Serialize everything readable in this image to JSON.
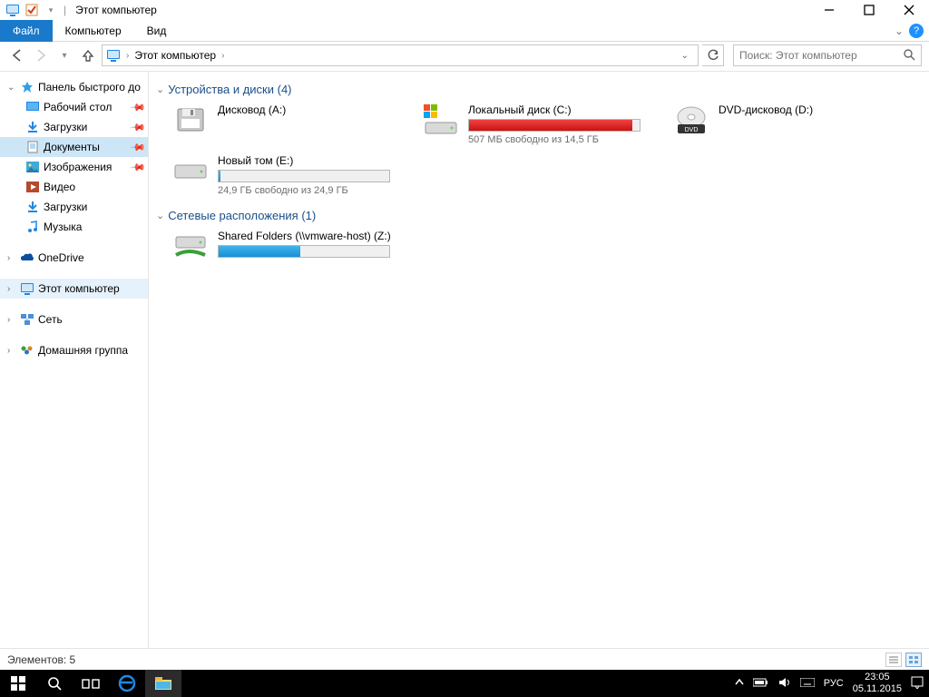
{
  "window": {
    "title": "Этот компьютер",
    "minimize_tip": "Свернуть",
    "maximize_tip": "Развернуть",
    "close_tip": "Закрыть"
  },
  "ribbon": {
    "tabs": {
      "file": "Файл",
      "computer": "Компьютер",
      "view": "Вид"
    }
  },
  "address": {
    "crumb": "Этот компьютер",
    "search_placeholder": "Поиск: Этот компьютер"
  },
  "nav": {
    "quick": {
      "label": "Панель быстрого до",
      "items": [
        {
          "label": "Рабочий стол",
          "pinned": true,
          "icon": "desktop"
        },
        {
          "label": "Загрузки",
          "pinned": true,
          "icon": "downloads"
        },
        {
          "label": "Документы",
          "pinned": true,
          "selected": true,
          "icon": "documents"
        },
        {
          "label": "Изображения",
          "pinned": true,
          "icon": "pictures"
        },
        {
          "label": "Видео",
          "pinned": false,
          "icon": "videos"
        },
        {
          "label": "Загрузки",
          "pinned": false,
          "icon": "downloads"
        },
        {
          "label": "Музыка",
          "pinned": false,
          "icon": "music"
        }
      ]
    },
    "onedrive": "OneDrive",
    "this_pc": "Этот компьютер",
    "network": "Сеть",
    "homegroup": "Домашняя группа"
  },
  "sections": {
    "devices": {
      "label": "Устройства и диски (4)"
    },
    "network": {
      "label": "Сетевые расположения (1)"
    }
  },
  "drives": [
    {
      "name": "Дисковод (A:)",
      "icon": "floppy",
      "status": ""
    },
    {
      "name": "Локальный диск (C:)",
      "icon": "winhdd",
      "status": "507 МБ свободно из 14,5 ГБ",
      "fill_pct": 96,
      "fill_color": "red"
    },
    {
      "name": "DVD-дисковод (D:)",
      "icon": "dvd",
      "status": ""
    },
    {
      "name": "Новый том (E:)",
      "icon": "hdd",
      "status": "24,9 ГБ свободно из 24,9 ГБ",
      "fill_pct": 1,
      "fill_color": "blue"
    }
  ],
  "netlocs": [
    {
      "name": "Shared Folders (\\\\vmware-host) (Z:)",
      "icon": "netdrive",
      "status": "",
      "fill_pct": 48,
      "fill_color": "blue"
    }
  ],
  "statusbar": {
    "text": "Элементов: 5"
  },
  "taskbar": {
    "lang": "РУС",
    "clock_time": "23:05",
    "clock_date": "05.11.2015"
  }
}
